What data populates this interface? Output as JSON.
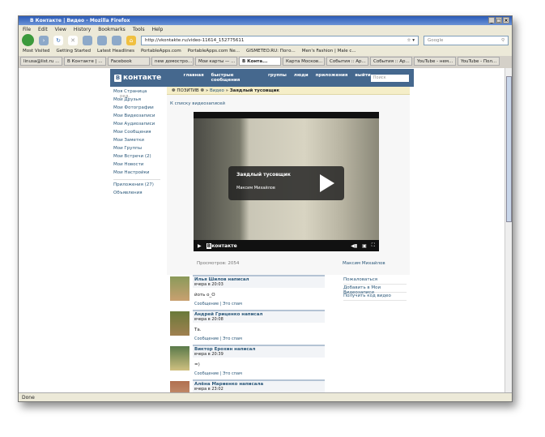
{
  "browser": {
    "title": "В Контакте | Видео - Mozilla Firefox",
    "menu": [
      "File",
      "Edit",
      "View",
      "History",
      "Bookmarks",
      "Tools",
      "Help"
    ],
    "url": "http://vkontakte.ru/video-11614_152775611",
    "search_placeholder": "Google",
    "bookmarks": [
      "Most Visited",
      "Getting Started",
      "Latest Headlines",
      "PortableApps.com",
      "PortableApps.com Ne...",
      "GISMETEO.RU: Пого...",
      "Men's Fashion | Male c..."
    ],
    "tabs": [
      "linusa@list.ru ...",
      "В Контакте | ...",
      "Facebook",
      "new домостро...",
      "Мои карты — ...",
      "В Конта...",
      "Карта Москов...",
      "События :: Ар...",
      "События :: Ар...",
      "YouTube - нем...",
      "YouTube - Пол..."
    ],
    "status": "Done"
  },
  "vk": {
    "logo": "контакте",
    "logo_letter": "В",
    "nav": [
      "главная",
      "быстрые сообщения",
      "группы",
      "люди",
      "приложения",
      "выйти"
    ],
    "search_placeholder": "Поиск",
    "sidebar": [
      "Моя Страница",
      "Мои Друзья",
      "Мои Фотографии",
      "Мои Видеозаписи",
      "Мои Аудиозаписи",
      "Мои Сообщения",
      "Мои Заметки",
      "Мои Группы",
      "Мои Встречи (2)",
      "Мои Новости",
      "Мои Настройки"
    ],
    "sidebar_edit": "ред.",
    "sidebar_extra": [
      "Приложения (27)",
      "Объявления"
    ],
    "breadcrumb": {
      "group": "❁ ПОЗИТИВ ❁",
      "section": "Видео",
      "current": "Заядлый тусовщик"
    },
    "back_link": "К списку видеозаписей",
    "video": {
      "title": "Заядлый тусовщик",
      "author": "Максим Михайлов",
      "brand": "контакте"
    },
    "views": "Просмотров: 2054",
    "uploader": "Максим Михайлов",
    "actions": [
      "Пожаловаться",
      "Добавить в Мои Видеозаписи",
      "Получить код видео"
    ],
    "comments": [
      {
        "name": "Илья Шилов написал",
        "time": "вчера в 20:03",
        "text": "йоть о_О"
      },
      {
        "name": "Андрей Гриценко написал",
        "time": "вчера в 20:08",
        "text": "Та."
      },
      {
        "name": "Виктор Ерохин написал",
        "time": "вчера в 20:39",
        "text": "=)"
      },
      {
        "name": "Алёна Мариенко написала",
        "time": "вчера в 23:02",
        "text": ""
      }
    ],
    "comment_links": {
      "message": "Сообщение",
      "spam": "Это спам"
    }
  }
}
